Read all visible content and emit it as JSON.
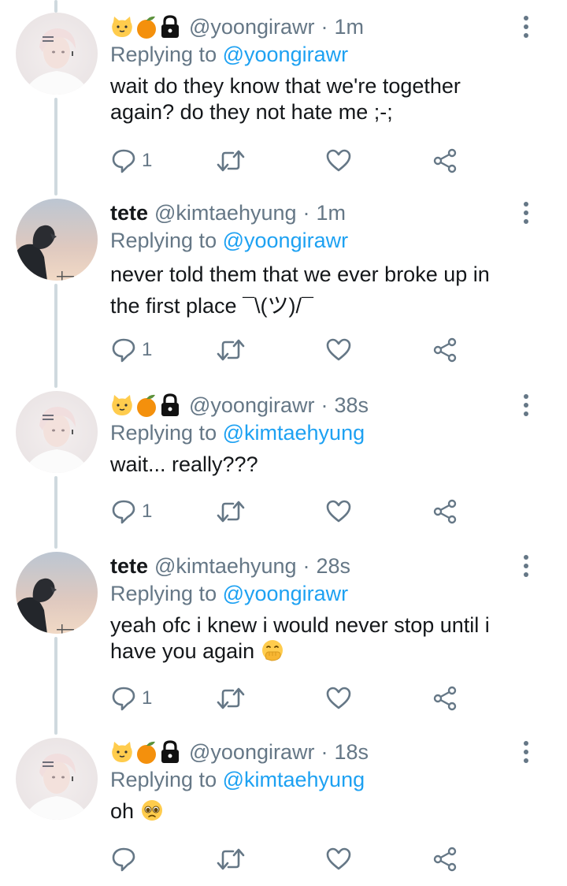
{
  "colors": {
    "link": "#1da1f2",
    "muted": "#657786",
    "text": "#14171a",
    "thread_line": "#cfd9de"
  },
  "tweets": [
    {
      "display_name": "",
      "name_emojis": [
        "cat-face-emoji",
        "tangerine-emoji",
        "lock-emoji"
      ],
      "handle": "@yoongirawr",
      "separator": "·",
      "time": "1m",
      "replying_prefix": "Replying to",
      "replying_handle": "@yoongirawr",
      "text_lines": [
        "wait do they know that we're together",
        "again? do they not hate me ;-;"
      ],
      "reply_count": "1",
      "avatar": "pink-hair-avatar"
    },
    {
      "display_name": "tete",
      "handle": "@kimtaehyung",
      "separator": "·",
      "time": "1m",
      "replying_prefix": "Replying to",
      "replying_handle": "@yoongirawr",
      "text_lines": [
        "never told them that we ever broke up in",
        "the first place ¯\\(ツ)/¯"
      ],
      "reply_count": "1",
      "avatar": "sky-silhouette-avatar"
    },
    {
      "display_name": "",
      "name_emojis": [
        "cat-face-emoji",
        "tangerine-emoji",
        "lock-emoji"
      ],
      "handle": "@yoongirawr",
      "separator": "·",
      "time": "38s",
      "replying_prefix": "Replying to",
      "replying_handle": "@kimtaehyung",
      "text_lines": [
        "wait... really???"
      ],
      "reply_count": "1",
      "avatar": "pink-hair-avatar"
    },
    {
      "display_name": "tete",
      "handle": "@kimtaehyung",
      "separator": "·",
      "time": "28s",
      "replying_prefix": "Replying to",
      "replying_handle": "@yoongirawr",
      "text_lines": [
        "yeah ofc i knew i would never stop until i",
        "have you again"
      ],
      "trailing_emoji": "hand-over-mouth-emoji",
      "reply_count": "1",
      "avatar": "sky-silhouette-avatar"
    },
    {
      "display_name": "",
      "name_emojis": [
        "cat-face-emoji",
        "tangerine-emoji",
        "lock-emoji"
      ],
      "handle": "@yoongirawr",
      "separator": "·",
      "time": "18s",
      "replying_prefix": "Replying to",
      "replying_handle": "@kimtaehyung",
      "text_lines": [
        "oh"
      ],
      "trailing_emoji": "pleading-face-emoji",
      "reply_count": "",
      "avatar": "pink-hair-avatar"
    }
  ]
}
